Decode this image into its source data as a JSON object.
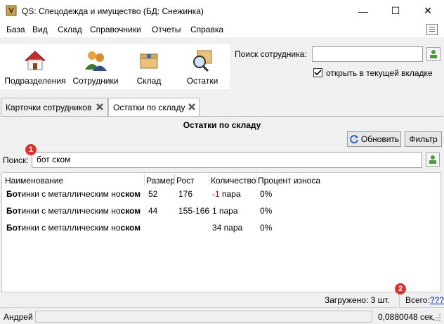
{
  "window": {
    "title": "QS: Спецодежда и имущество (БД: Снежинка)",
    "minimize": "—",
    "maximize": "☐",
    "close": "✕"
  },
  "menu": [
    "База",
    "Вид",
    "Склад",
    "Справочники",
    "Отчеты",
    "Справка"
  ],
  "toolbar": [
    {
      "label": "Подразделения",
      "icon": "house-icon"
    },
    {
      "label": "Сотрудники",
      "icon": "people-icon"
    },
    {
      "label": "Склад",
      "icon": "box-icon"
    },
    {
      "label": "Остатки",
      "icon": "magnifier-box-icon"
    }
  ],
  "employee_search": {
    "label": "Поиск сотрудника:",
    "value": "",
    "open_in_tab_label": "открыть в текущей вкладке",
    "open_in_tab_checked": true
  },
  "tabs": [
    {
      "label": "Карточки сотрудников",
      "active": false
    },
    {
      "label": "Остатки по складу",
      "active": true
    }
  ],
  "page": {
    "title": "Остатки по складу",
    "refresh_label": "Обновить",
    "filter_label": "Фильтр",
    "search_label": "Поиск:",
    "search_value": "бот ском"
  },
  "table": {
    "columns": [
      "Наименование",
      "Размер",
      "Рост",
      "Количество",
      "Процент износа"
    ],
    "rows": [
      {
        "name_bold1": "Бот",
        "name_mid": "инки с металлическим но",
        "name_bold2": "ском",
        "size": "52",
        "height": "176",
        "qty": "-1 пара",
        "qty_negative": true,
        "wear": "0%"
      },
      {
        "name_bold1": "Бот",
        "name_mid": "инки с металлическим но",
        "name_bold2": "ском",
        "size": "44",
        "height": "155-166",
        "qty": "1 пара",
        "qty_negative": false,
        "wear": "0%"
      },
      {
        "name_bold1": "Бот",
        "name_mid": "инки с металлическим но",
        "name_bold2": "ском",
        "size": "",
        "height": "",
        "qty": "34 пара",
        "qty_negative": false,
        "wear": "0%"
      }
    ]
  },
  "footer": {
    "loaded": "Загружено: 3 шт.",
    "total_label": "Всего:",
    "total_value": "???"
  },
  "status": {
    "user": "Андрей",
    "time": "0,0880048 сек."
  },
  "annotations": {
    "badge1": "1",
    "badge2": "2"
  },
  "colors": {
    "negative": "#c00000",
    "badge": "#d9342b",
    "link": "#0033cc"
  }
}
